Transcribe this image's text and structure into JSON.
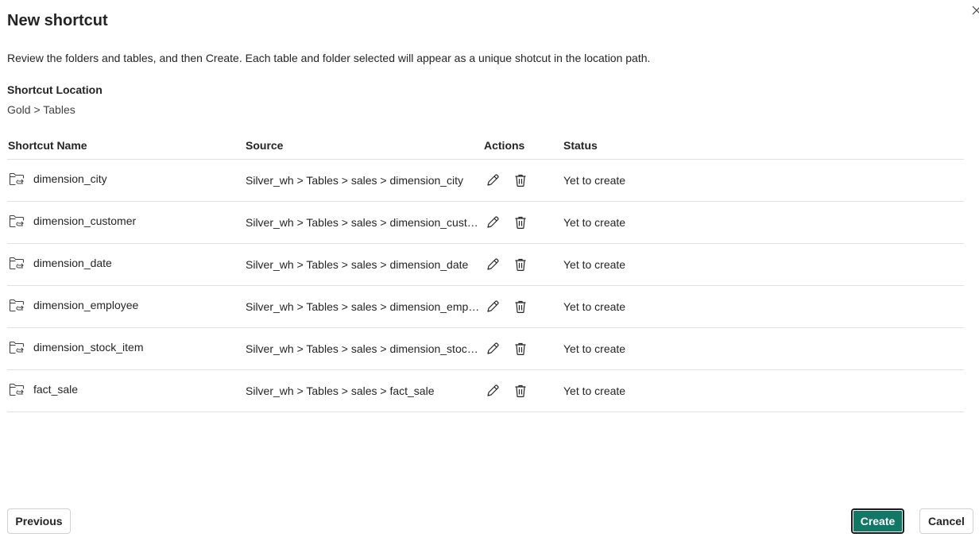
{
  "dialog": {
    "title": "New shortcut",
    "description": "Review the folders and tables, and then Create. Each table and folder selected will appear as a unique shotcut in the location path.",
    "location_label": "Shortcut Location",
    "location_value": "Gold > Tables"
  },
  "table": {
    "headers": {
      "name": "Shortcut Name",
      "source": "Source",
      "actions": "Actions",
      "status": "Status"
    },
    "rows": [
      {
        "name": "dimension_city",
        "source": "Silver_wh > Tables > sales > dimension_city",
        "status": "Yet to create"
      },
      {
        "name": "dimension_customer",
        "source": "Silver_wh > Tables > sales > dimension_customer",
        "status": "Yet to create"
      },
      {
        "name": "dimension_date",
        "source": "Silver_wh > Tables > sales > dimension_date",
        "status": "Yet to create"
      },
      {
        "name": "dimension_employee",
        "source": "Silver_wh > Tables > sales > dimension_employee",
        "status": "Yet to create"
      },
      {
        "name": "dimension_stock_item",
        "source": "Silver_wh > Tables > sales > dimension_stock_item",
        "status": "Yet to create"
      },
      {
        "name": "fact_sale",
        "source": "Silver_wh > Tables > sales > fact_sale",
        "status": "Yet to create"
      }
    ]
  },
  "buttons": {
    "previous": "Previous",
    "create": "Create",
    "cancel": "Cancel"
  },
  "icons": {
    "row_icon": "folder-shortcut-icon",
    "edit": "pencil-icon",
    "delete": "trash-icon",
    "close": "close-icon"
  },
  "colors": {
    "primary": "#117865",
    "divider": "#e0e0e0"
  }
}
